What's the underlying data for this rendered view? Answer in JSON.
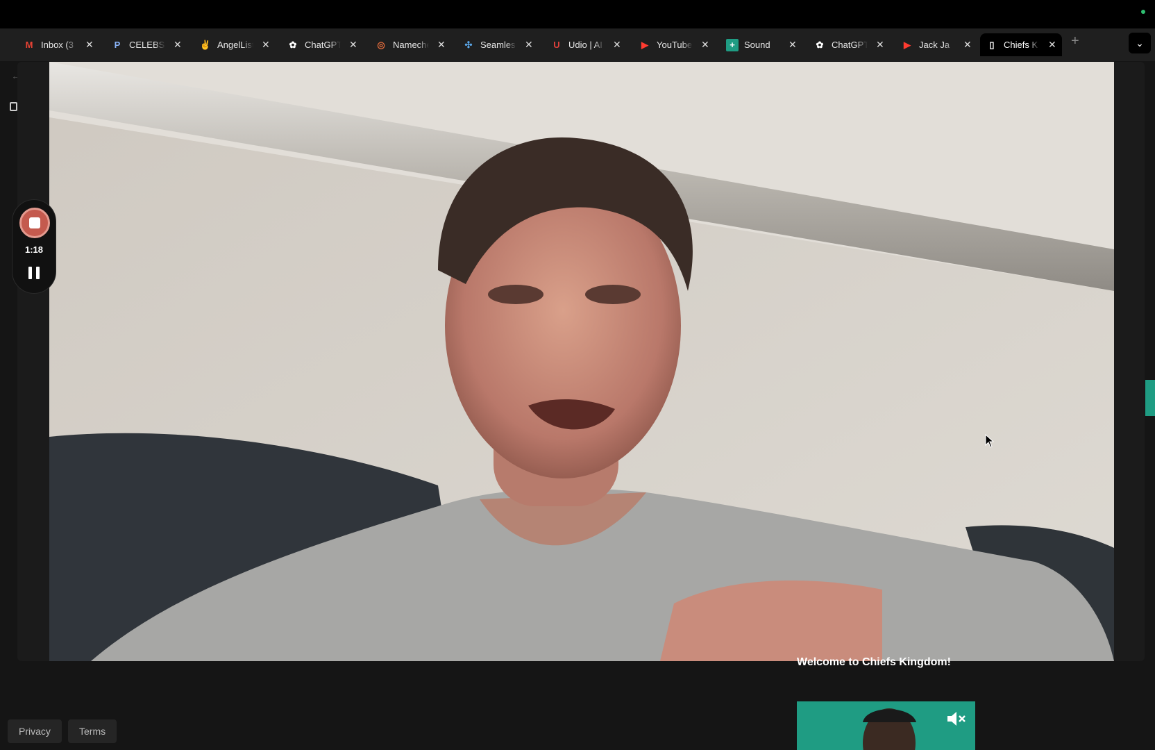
{
  "tabs": [
    {
      "title": "Inbox (3",
      "icon": "gmail-icon"
    },
    {
      "title": "CELEBS",
      "icon": "celebs-icon"
    },
    {
      "title": "AngelList",
      "icon": "angellist-icon"
    },
    {
      "title": "ChatGPT",
      "icon": "chatgpt-icon"
    },
    {
      "title": "Namecheap",
      "icon": "namecheap-icon"
    },
    {
      "title": "Seamless",
      "icon": "seamless-icon"
    },
    {
      "title": "Udio | AI",
      "icon": "udio-icon"
    },
    {
      "title": "YouTube",
      "icon": "youtube-icon"
    },
    {
      "title": "Sound",
      "icon": "sound-icon"
    },
    {
      "title": "ChatGPT",
      "icon": "chatgpt-icon"
    },
    {
      "title": "Jack Ja",
      "icon": "youtube-icon"
    },
    {
      "title": "Chiefs K",
      "icon": "doc-icon",
      "active": true
    }
  ],
  "close_glyph": "✕",
  "new_tab_glyph": "+",
  "recorder": {
    "time": "1:18"
  },
  "page": {
    "welcome": "Welcome to Chiefs Kingdom!",
    "footer": {
      "privacy": "Privacy",
      "terms": "Terms"
    }
  },
  "colors": {
    "record_red": "#c45a4e",
    "teal": "#1f9c83"
  }
}
